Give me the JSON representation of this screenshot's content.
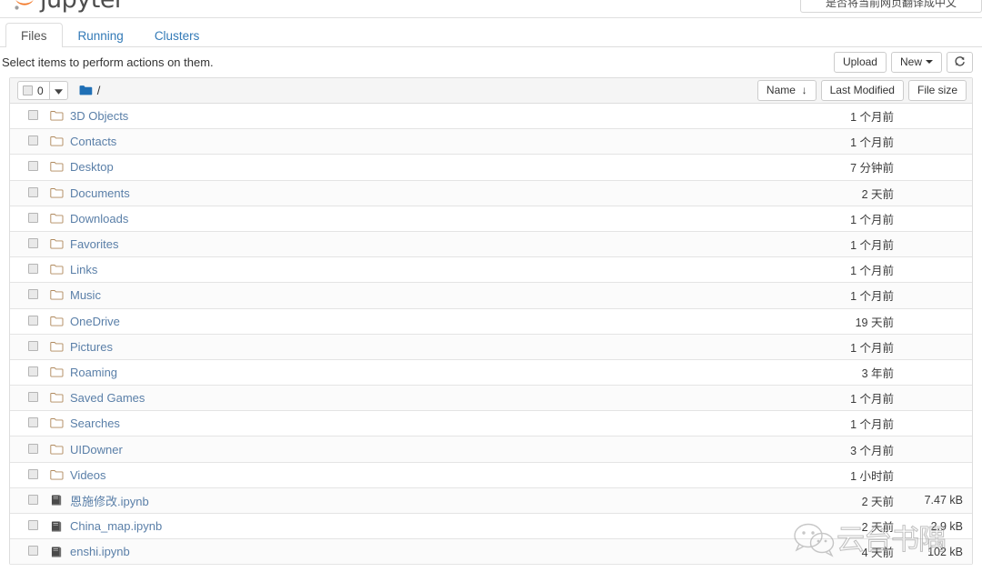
{
  "brand": {
    "name": "jupyter",
    "logo_icon": "jupyter-logo-icon"
  },
  "translate_prompt": {
    "text": "是否将当前网页翻译成中文"
  },
  "tabs": [
    {
      "label": "Files",
      "active": true
    },
    {
      "label": "Running",
      "active": false
    },
    {
      "label": "Clusters",
      "active": false
    }
  ],
  "action_bar": {
    "hint": "Select items to perform actions on them.",
    "upload_label": "Upload",
    "new_label": "New",
    "refresh_icon": "refresh-icon"
  },
  "list_header": {
    "selected_count": "0",
    "select_caret_icon": "chevron-down-icon",
    "folder_icon": "folder-icon",
    "path": "/",
    "sort_name_label": "Name",
    "sort_name_arrow": "▼",
    "sort_modified_label": "Last Modified",
    "sort_size_label": "File size"
  },
  "files": [
    {
      "name": "3D Objects",
      "type": "folder",
      "icon": "folder-icon",
      "modified": "1 个月前",
      "size": ""
    },
    {
      "name": "Contacts",
      "type": "folder",
      "icon": "folder-icon",
      "modified": "1 个月前",
      "size": ""
    },
    {
      "name": "Desktop",
      "type": "folder",
      "icon": "folder-icon",
      "modified": "7 分钟前",
      "size": ""
    },
    {
      "name": "Documents",
      "type": "folder",
      "icon": "folder-icon",
      "modified": "2 天前",
      "size": ""
    },
    {
      "name": "Downloads",
      "type": "folder",
      "icon": "folder-icon",
      "modified": "1 个月前",
      "size": ""
    },
    {
      "name": "Favorites",
      "type": "folder",
      "icon": "folder-icon",
      "modified": "1 个月前",
      "size": ""
    },
    {
      "name": "Links",
      "type": "folder",
      "icon": "folder-icon",
      "modified": "1 个月前",
      "size": ""
    },
    {
      "name": "Music",
      "type": "folder",
      "icon": "folder-icon",
      "modified": "1 个月前",
      "size": ""
    },
    {
      "name": "OneDrive",
      "type": "folder",
      "icon": "folder-icon",
      "modified": "19 天前",
      "size": ""
    },
    {
      "name": "Pictures",
      "type": "folder",
      "icon": "folder-icon",
      "modified": "1 个月前",
      "size": ""
    },
    {
      "name": "Roaming",
      "type": "folder",
      "icon": "folder-icon",
      "modified": "3 年前",
      "size": ""
    },
    {
      "name": "Saved Games",
      "type": "folder",
      "icon": "folder-icon",
      "modified": "1 个月前",
      "size": ""
    },
    {
      "name": "Searches",
      "type": "folder",
      "icon": "folder-icon",
      "modified": "1 个月前",
      "size": ""
    },
    {
      "name": "UIDowner",
      "type": "folder",
      "icon": "folder-icon",
      "modified": "3 个月前",
      "size": ""
    },
    {
      "name": "Videos",
      "type": "folder",
      "icon": "folder-icon",
      "modified": "1 小时前",
      "size": ""
    },
    {
      "name": "恩施修改.ipynb",
      "type": "notebook",
      "icon": "notebook-icon",
      "modified": "2 天前",
      "size": "7.47 kB"
    },
    {
      "name": "China_map.ipynb",
      "type": "notebook",
      "icon": "notebook-icon",
      "modified": "2 天前",
      "size": "2.9 kB"
    },
    {
      "name": "enshi.ipynb",
      "type": "notebook",
      "icon": "notebook-icon",
      "modified": "4 天前",
      "size": "102 kB"
    }
  ],
  "watermark": {
    "text": "云台书隅",
    "logo_icon": "wechat-icon"
  },
  "colors": {
    "link": "#5a7fa8",
    "tab_active": "#555555",
    "folder_blue": "#1f6fb5",
    "logo_orange": "#f37726",
    "border": "#dddddd",
    "header_bg": "#f5f5f5"
  }
}
